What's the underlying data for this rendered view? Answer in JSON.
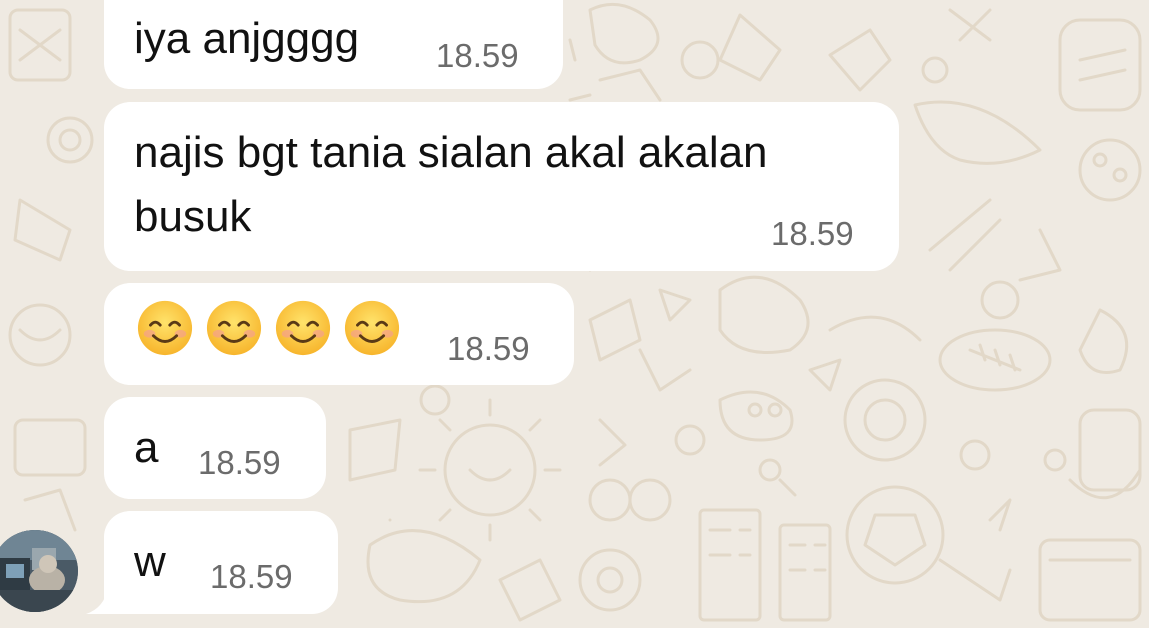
{
  "chat": {
    "messages": [
      {
        "text": "iya anjgggg",
        "time": "18.59"
      },
      {
        "text_line1": "najis bgt tania sialan akal akalan",
        "text_line2": "busuk",
        "time": "18.59"
      },
      {
        "emoji": "smiling-face-with-smiling-eyes",
        "emoji_count": 4,
        "time": "18.59"
      },
      {
        "text": "a",
        "time": "18.59"
      },
      {
        "text": "w",
        "time": "18.59"
      }
    ]
  },
  "colors": {
    "background": "#efeae2",
    "bubble": "#ffffff",
    "text": "#111111",
    "timestamp": "#6b6b6b",
    "wallpaper_doodle": "#e2d8c8"
  }
}
